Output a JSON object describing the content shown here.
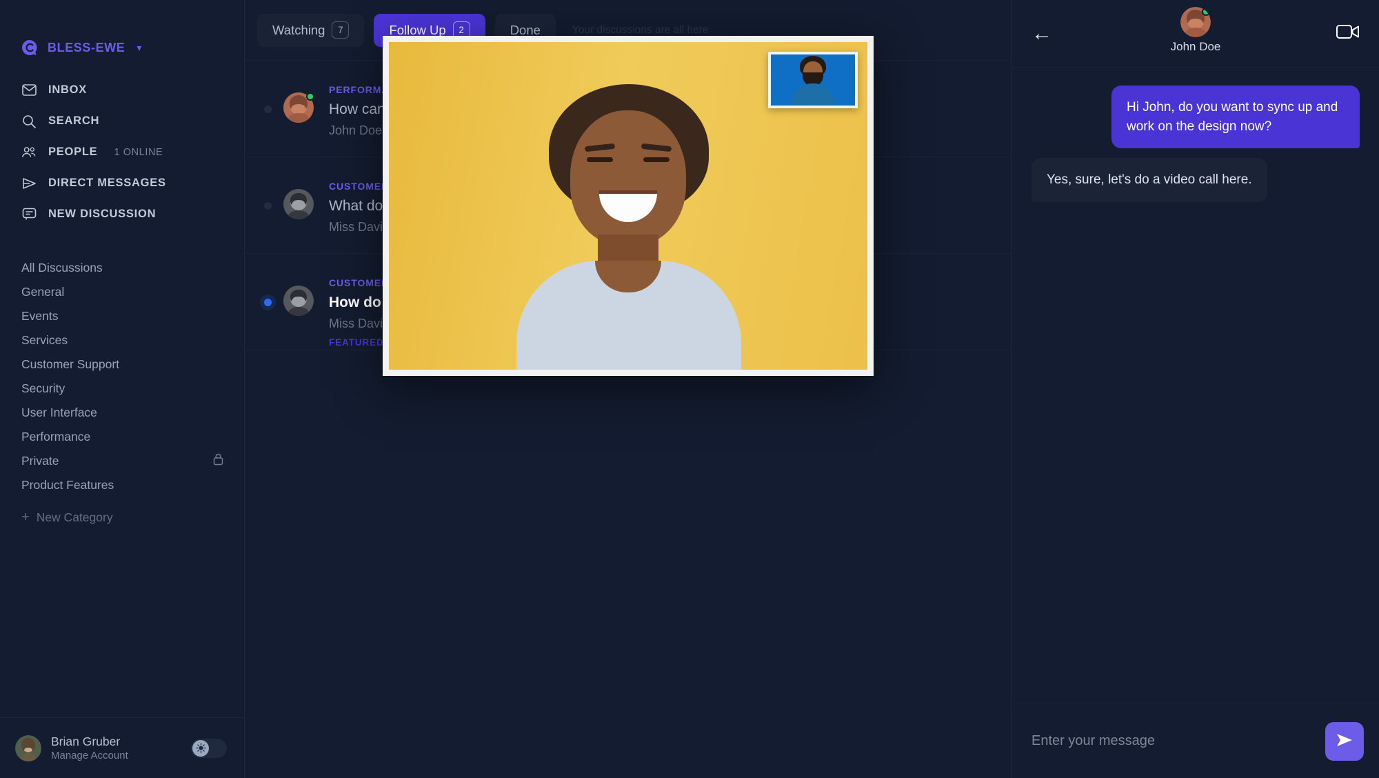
{
  "sidebar": {
    "brand": {
      "name": "BLESS-EWE",
      "logo_icon": "chat-logo-icon",
      "caret_icon": "chevron-down-icon"
    },
    "nav": [
      {
        "label": "INBOX",
        "icon": "envelope-icon",
        "sub": ""
      },
      {
        "label": "SEARCH",
        "icon": "search-icon",
        "sub": ""
      },
      {
        "label": "PEOPLE",
        "icon": "people-icon",
        "sub": "1 ONLINE"
      },
      {
        "label": "DIRECT MESSAGES",
        "icon": "paper-plane-icon",
        "sub": ""
      },
      {
        "label": "NEW DISCUSSION",
        "icon": "chat-bubble-icon",
        "sub": ""
      }
    ],
    "categories": [
      {
        "label": "All Discussions",
        "locked": false
      },
      {
        "label": "General",
        "locked": false
      },
      {
        "label": "Events",
        "locked": false
      },
      {
        "label": "Services",
        "locked": false
      },
      {
        "label": "Customer Support",
        "locked": false
      },
      {
        "label": "Security",
        "locked": false
      },
      {
        "label": "User Interface",
        "locked": false
      },
      {
        "label": "Performance",
        "locked": false
      },
      {
        "label": "Private",
        "locked": true
      },
      {
        "label": "Product Features",
        "locked": false
      }
    ],
    "new_category": {
      "label": "New Category",
      "icon": "plus-icon"
    },
    "profile": {
      "name": "Brian Gruber",
      "subtitle": "Manage Account",
      "avatar_name": "brian-gruber-avatar",
      "theme_toggle_icon": "sun-icon"
    }
  },
  "main": {
    "tabs": [
      {
        "label": "Watching",
        "count": "7",
        "active": false
      },
      {
        "label": "Follow Up",
        "count": "2",
        "active": true
      },
      {
        "label": "Done",
        "count": "",
        "active": false
      }
    ],
    "tab_hint": "Your discussions are all here",
    "rows": [
      {
        "category": "PERFORMANCE",
        "title": "How can I improve the loading speed?",
        "snippet": "John Doe: The system is built to handle a wide range of tasks",
        "tag": "",
        "unread": false,
        "online": true,
        "avatar_name": "discussion-avatar-1"
      },
      {
        "category": "CUSTOMER SUPPORT",
        "title": "What does the support plan include?",
        "snippet": "Miss Davis: Let us know about any third-party questions",
        "tag": "",
        "unread": false,
        "online": false,
        "avatar_name": "discussion-avatar-2"
      },
      {
        "category": "CUSTOMER SUPPORT",
        "title": "How do I contact the support team?",
        "snippet": "Miss Davis: Every team member on the team has the tools they need",
        "tag": "FEATURED",
        "unread": true,
        "online": false,
        "avatar_name": "discussion-avatar-3"
      }
    ]
  },
  "chat": {
    "back_icon": "back-arrow-icon",
    "contact_name": "John Doe",
    "contact_avatar_name": "john-doe-avatar",
    "online": true,
    "video_icon": "video-camera-icon",
    "messages": [
      {
        "direction": "out",
        "text": "Hi John, do you want to sync up and work on the design now?"
      },
      {
        "direction": "in",
        "text": "Yes, sure, let's do a video call here."
      }
    ],
    "composer": {
      "value": "",
      "placeholder": "Enter your message",
      "send_icon": "send-icon"
    }
  },
  "call_overlay": {
    "main_video_name": "remote-video-feed",
    "pip_video_name": "self-video-feed"
  },
  "colors": {
    "accent": "#6c5ce7",
    "accent_active": "#4b34d6",
    "unread": "#2b6bff",
    "online": "#23d160",
    "bg": "#131c30"
  }
}
